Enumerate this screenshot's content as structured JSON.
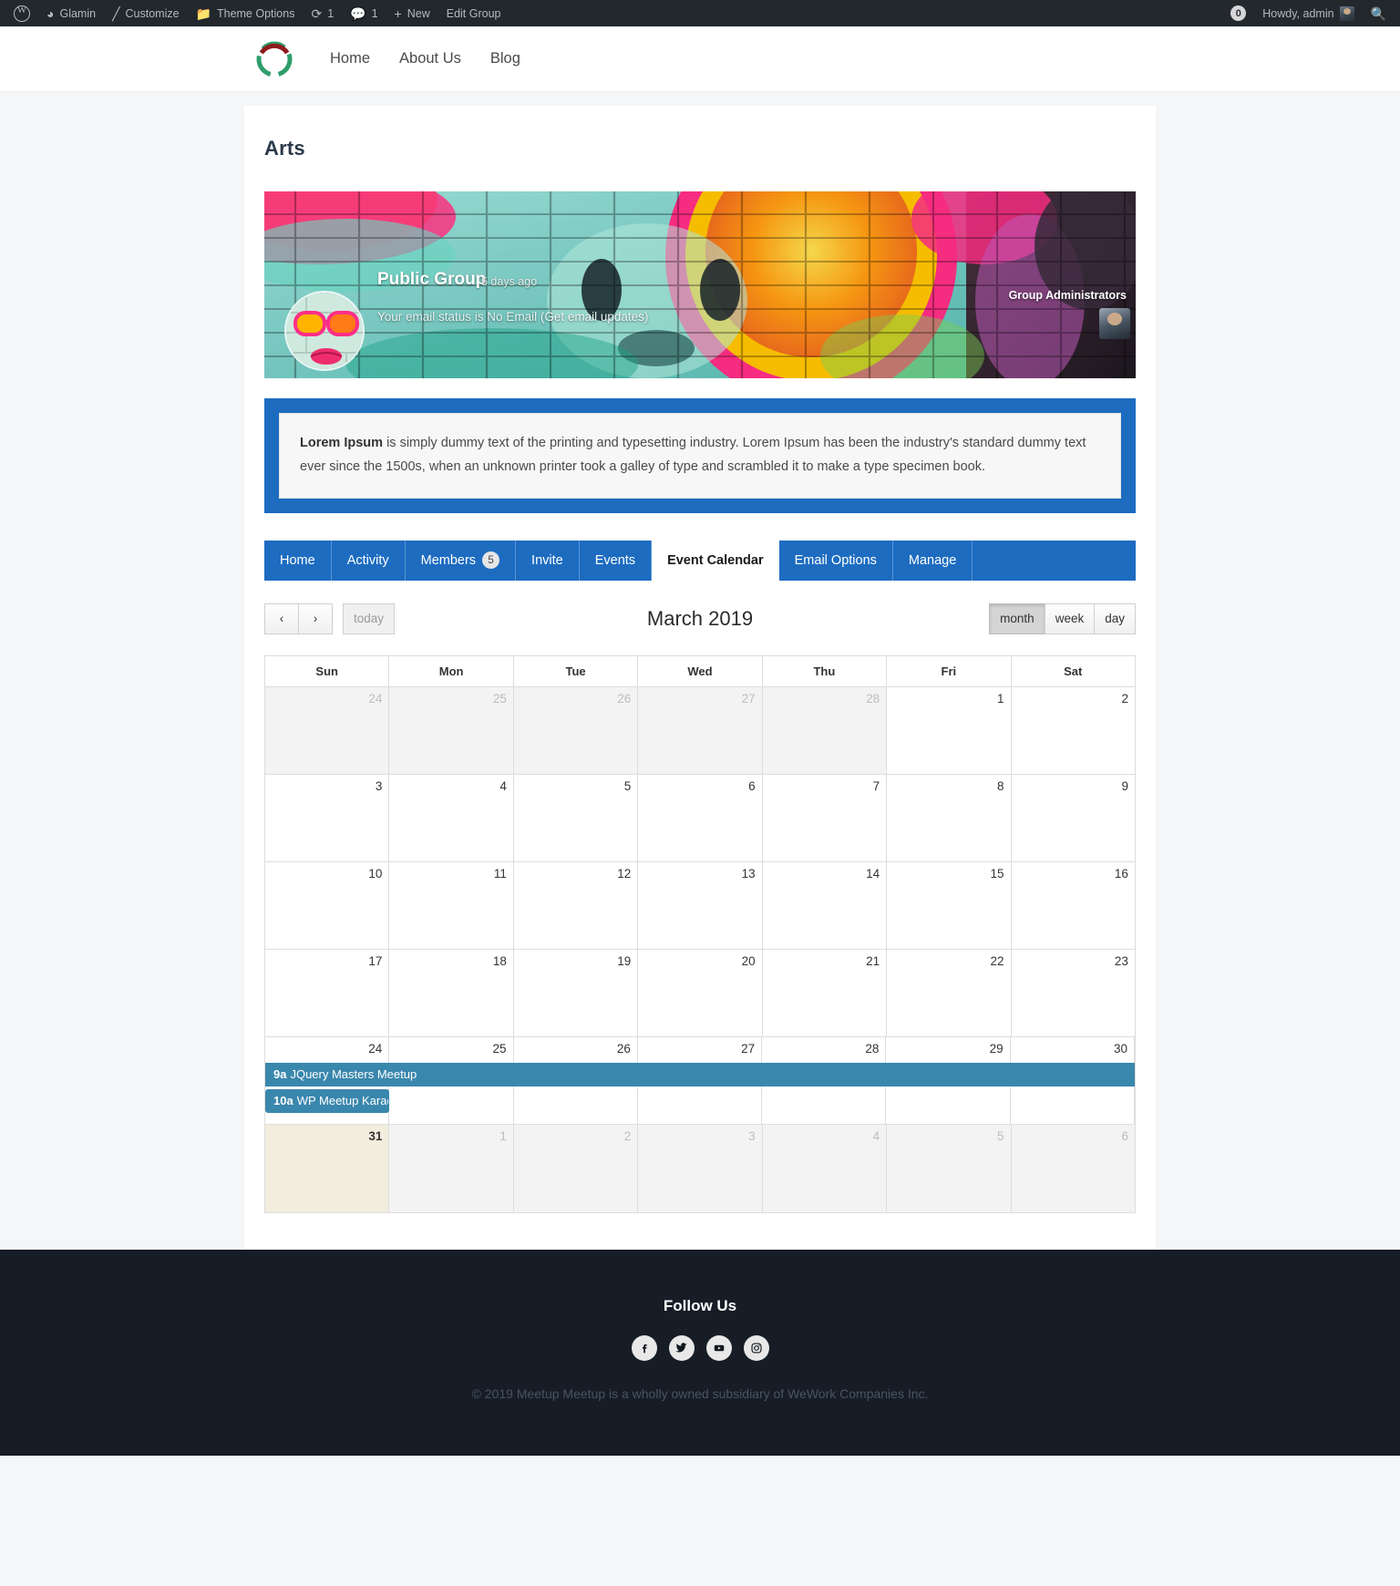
{
  "adminbar": {
    "logo_icon": "wordpress-logo-icon",
    "items": [
      {
        "icon": "dashboard-icon",
        "label": "Glamin"
      },
      {
        "icon": "paintbrush-icon",
        "label": "Customize"
      },
      {
        "icon": "theme-options-icon",
        "label": "Theme Options"
      },
      {
        "icon": "updates-icon",
        "label": "",
        "count": "1"
      },
      {
        "icon": "comment-bubble-icon",
        "label": "",
        "count": "1"
      },
      {
        "icon": "plus-icon",
        "label": "New"
      },
      {
        "icon": "",
        "label": "Edit Group"
      }
    ],
    "notification_count": "0",
    "howdy": "Howdy, admin",
    "search_icon": "search-icon"
  },
  "header": {
    "logo_name": "site-logo",
    "nav": [
      {
        "label": "Home"
      },
      {
        "label": "About Us"
      },
      {
        "label": "Blog"
      }
    ]
  },
  "group": {
    "title": "Arts",
    "status": "Public Group",
    "last_active": "5 days ago",
    "email_status_text": "Your email status is No Email (",
    "email_link_text": "Get email updates",
    "email_status_tail": ")",
    "admins_label": "Group Administrators"
  },
  "notice": {
    "lead": "Lorem Ipsum",
    "body": " is simply dummy text of the printing and typesetting industry. Lorem Ipsum has been the industry's standard dummy text ever since the 1500s, when an unknown printer took a galley of type and scrambled it to make a type specimen book."
  },
  "tabs": [
    {
      "label": "Home",
      "count": null,
      "active": false
    },
    {
      "label": "Activity",
      "count": null,
      "active": false
    },
    {
      "label": "Members",
      "count": "5",
      "active": false
    },
    {
      "label": "Invite",
      "count": null,
      "active": false
    },
    {
      "label": "Events",
      "count": null,
      "active": false
    },
    {
      "label": "Event Calendar",
      "count": null,
      "active": true
    },
    {
      "label": "Email Options",
      "count": null,
      "active": false
    },
    {
      "label": "Manage",
      "count": null,
      "active": false
    }
  ],
  "calendar": {
    "prev_label": "‹",
    "next_label": "›",
    "today_label": "today",
    "title": "March 2019",
    "views": [
      {
        "label": "month",
        "active": true
      },
      {
        "label": "week",
        "active": false
      },
      {
        "label": "day",
        "active": false
      }
    ],
    "daynames": [
      "Sun",
      "Mon",
      "Tue",
      "Wed",
      "Thu",
      "Fri",
      "Sat"
    ],
    "event_color": "#3a87ad",
    "today_bg": "#f2eddd",
    "weeks": [
      [
        {
          "num": "24",
          "other": true
        },
        {
          "num": "25",
          "other": true
        },
        {
          "num": "26",
          "other": true
        },
        {
          "num": "27",
          "other": true
        },
        {
          "num": "28",
          "other": true
        },
        {
          "num": "1",
          "other": false
        },
        {
          "num": "2",
          "other": false
        }
      ],
      [
        {
          "num": "3",
          "other": false
        },
        {
          "num": "4",
          "other": false
        },
        {
          "num": "5",
          "other": false
        },
        {
          "num": "6",
          "other": false
        },
        {
          "num": "7",
          "other": false
        },
        {
          "num": "8",
          "other": false
        },
        {
          "num": "9",
          "other": false
        }
      ],
      [
        {
          "num": "10",
          "other": false
        },
        {
          "num": "11",
          "other": false
        },
        {
          "num": "12",
          "other": false
        },
        {
          "num": "13",
          "other": false
        },
        {
          "num": "14",
          "other": false
        },
        {
          "num": "15",
          "other": false
        },
        {
          "num": "16",
          "other": false
        }
      ],
      [
        {
          "num": "17",
          "other": false
        },
        {
          "num": "18",
          "other": false
        },
        {
          "num": "19",
          "other": false
        },
        {
          "num": "20",
          "other": false
        },
        {
          "num": "21",
          "other": false
        },
        {
          "num": "22",
          "other": false
        },
        {
          "num": "23",
          "other": false
        }
      ],
      [
        {
          "num": "24",
          "other": false
        },
        {
          "num": "25",
          "other": false
        },
        {
          "num": "26",
          "other": false
        },
        {
          "num": "27",
          "other": false
        },
        {
          "num": "28",
          "other": false
        },
        {
          "num": "29",
          "other": false
        },
        {
          "num": "30",
          "other": false
        }
      ],
      [
        {
          "num": "31",
          "other": false,
          "today": true
        },
        {
          "num": "1",
          "other": true
        },
        {
          "num": "2",
          "other": true
        },
        {
          "num": "3",
          "other": true
        },
        {
          "num": "4",
          "other": true
        },
        {
          "num": "5",
          "other": true
        },
        {
          "num": "6",
          "other": true
        }
      ]
    ],
    "events": [
      {
        "time": "9a",
        "title": "JQuery Masters Meetup",
        "week": 4,
        "start_col": 0,
        "span": 7,
        "row": 0
      },
      {
        "time": "10a",
        "title": "WP Meetup Karachi",
        "week": 4,
        "start_col": 0,
        "span": 1,
        "row": 1
      }
    ]
  },
  "footer": {
    "title": "Follow Us",
    "social": [
      {
        "name": "facebook-icon"
      },
      {
        "name": "twitter-icon"
      },
      {
        "name": "youtube-icon"
      },
      {
        "name": "instagram-icon"
      }
    ],
    "copyright": "© 2019 Meetup Meetup is a wholly owned subsidiary of WeWork Companies Inc."
  }
}
